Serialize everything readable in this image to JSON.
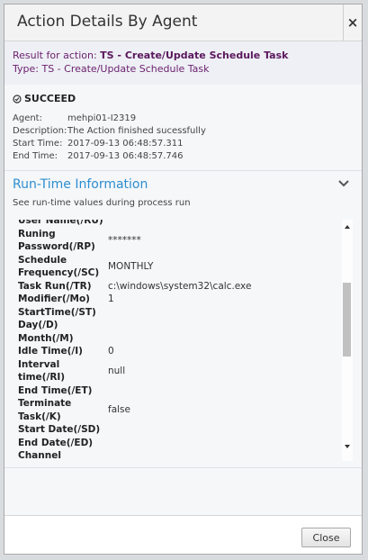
{
  "dialog": {
    "title": "Action Details By Agent",
    "close_glyph": "×"
  },
  "result": {
    "action_prefix": "Result for action: ",
    "action_name": "TS - Create/Update Schedule Task",
    "type_line": "Type: TS - Create/Update Schedule Task"
  },
  "status": {
    "icon": "clock-check-icon",
    "label": "SUCCEED"
  },
  "info": [
    {
      "label": "Agent:",
      "value": "mehpi01-I2319"
    },
    {
      "label": "Description:",
      "value": "The Action finished sucessfully"
    },
    {
      "label": "Start Time:",
      "value": "2017-09-13 06:48:57.311"
    },
    {
      "label": "End Time:",
      "value": "2017-09-13 06:48:57.746"
    }
  ],
  "runtime": {
    "title": "Run-Time Information",
    "description": "See run-time values during process run",
    "params": [
      {
        "label": "User Name(/RU)",
        "value": ""
      },
      {
        "label": "Runing Password(/RP)",
        "value": "*******"
      },
      {
        "label": "Schedule Frequency(/SC)",
        "value": "MONTHLY"
      },
      {
        "label": "Task Run(/TR)",
        "value": "c:\\windows\\system32\\calc.exe"
      },
      {
        "label": "Modifier(/Mo)",
        "value": "1"
      },
      {
        "label": "StartTime(/ST)",
        "value": ""
      },
      {
        "label": "Day(/D)",
        "value": ""
      },
      {
        "label": "Month(/M)",
        "value": ""
      },
      {
        "label": "Idle Time(/I)",
        "value": "0"
      },
      {
        "label": "Interval time(/RI)",
        "value": "null"
      },
      {
        "label": "End Time(/ET)",
        "value": ""
      },
      {
        "label": "Terminate Task(/K)",
        "value": "false"
      },
      {
        "label": "Start Date(/SD)",
        "value": ""
      },
      {
        "label": "End Date(/ED)",
        "value": ""
      },
      {
        "label": "Channel Name(/EC)",
        "value": ""
      }
    ]
  },
  "footer": {
    "close_label": "Close"
  }
}
